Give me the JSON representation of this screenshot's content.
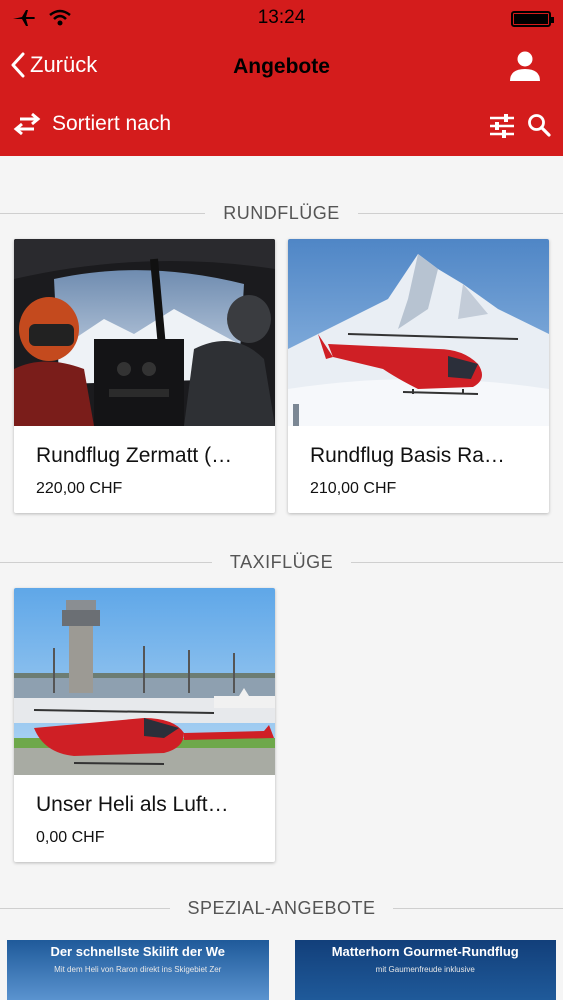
{
  "status_bar": {
    "time": "13:24"
  },
  "nav": {
    "back_label": "Zurück",
    "title": "Angebote"
  },
  "toolbar": {
    "sort_label": "Sortiert nach"
  },
  "sections": [
    {
      "title": "RUNDFLÜGE",
      "cards": [
        {
          "title": "Rundflug Zermatt (…",
          "price": "220,00 CHF"
        },
        {
          "title": "Rundflug Basis Ra…",
          "price": "210,00 CHF"
        }
      ]
    },
    {
      "title": "TAXIFLÜGE",
      "cards": [
        {
          "title": "Unser Heli als Luft…",
          "price": "0,00 CHF"
        }
      ]
    },
    {
      "title": "SPEZIAL-ANGEBOTE",
      "cards": [
        {
          "headline": "Der schnellste Skilift der We",
          "sub": "Mit dem Heli von Raron direkt ins Skigebiet Zer"
        },
        {
          "headline": "Matterhorn Gourmet-Rundflug",
          "sub": "mit Gaumenfreude inklusive"
        }
      ]
    }
  ],
  "colors": {
    "brand_red": "#d41c1c",
    "background": "#f5f5f5"
  }
}
